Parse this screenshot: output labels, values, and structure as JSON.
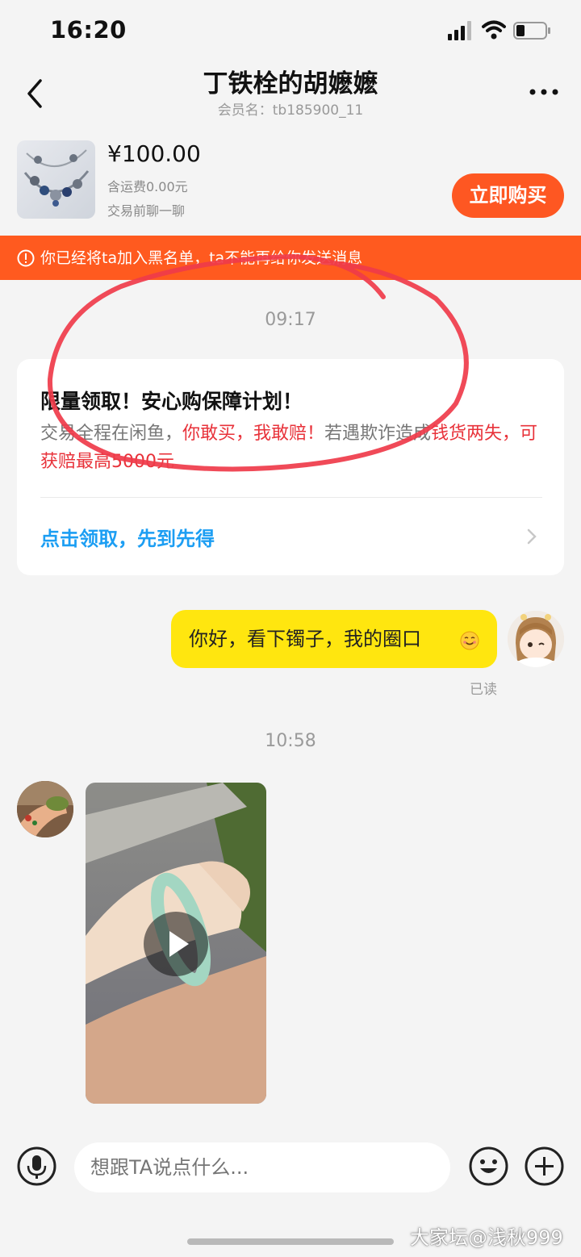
{
  "status_bar": {
    "time": "16:20"
  },
  "header": {
    "title": "丁铁栓的胡嬷嬷",
    "subtitle": "会员名：tb185900_11"
  },
  "product": {
    "price": "¥100.00",
    "shipping": "含运费0.00元",
    "chat_hint": "交易前聊一聊",
    "buy_label": "立即购买"
  },
  "banner": {
    "text": "你已经将ta加入黑名单，ta不能再给你发送消息"
  },
  "messages": {
    "time1": "09:17",
    "time2": "10:58",
    "promo": {
      "title": "限量领取！安心购保障计划！",
      "body_1": "交易全程在闲鱼，",
      "body_2": "你敢买，我敢赔！",
      "body_3": "若遇欺诈造成",
      "body_4": "钱货两失，可获赔最高5000元",
      "link": "点击领取，先到先得"
    },
    "my_text": "你好，看下镯子，我的圈口",
    "read_status": "已读"
  },
  "input": {
    "placeholder": "想跟TA说点什么..."
  },
  "watermark": "大家坛@浅秋999",
  "colors": {
    "accent": "#fe5722",
    "banner": "#ff5a1f",
    "bubble": "#ffe60f",
    "link": "#1c9ef3",
    "ink": "#ef3b4a"
  }
}
